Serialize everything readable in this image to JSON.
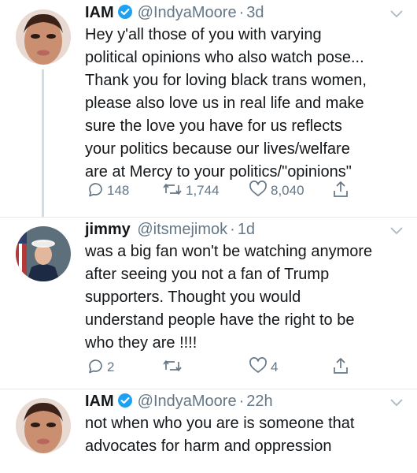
{
  "tweets": [
    {
      "name": "IAM",
      "handle": "@IndyaMoore",
      "separator": "·",
      "time": "3d",
      "lines": [
        "Hey y'all those of you with varying",
        "political opinions who also watch pose...",
        "Thank you for loving black trans women,",
        "please also love us in real life and make",
        "sure the love you have for us reflects",
        "your politics because our lives/welfare",
        "are at Mercy to your politics/\"opinions\""
      ],
      "replies": "148",
      "retweets": "1,744",
      "likes": "8,040"
    },
    {
      "name": "jimmy",
      "handle": "@itsmejimok",
      "separator": "·",
      "time": "1d",
      "lines": [
        "was a big fan won't be watching anymore",
        "after seeing you not a fan of Trump",
        "supporters. Thought you would",
        "understand people have the right to be",
        "who they are !!!!"
      ],
      "replies": "2",
      "retweets": "",
      "likes": "4"
    },
    {
      "name": "IAM",
      "handle": "@IndyaMoore",
      "separator": "·",
      "time": "22h",
      "lines": [
        "not when who you are is someone that",
        "advocates for harm and oppression"
      ]
    }
  ],
  "icons": {
    "verified": "verified-badge-icon",
    "caret": "chevron-down-icon",
    "reply": "reply-icon",
    "retweet": "retweet-icon",
    "like": "heart-icon",
    "share": "share-icon"
  },
  "colors": {
    "verified": "#1da1f2",
    "secondary_text": "#657786",
    "thread_line": "#d3dce3",
    "divider": "#e1e8ed"
  }
}
